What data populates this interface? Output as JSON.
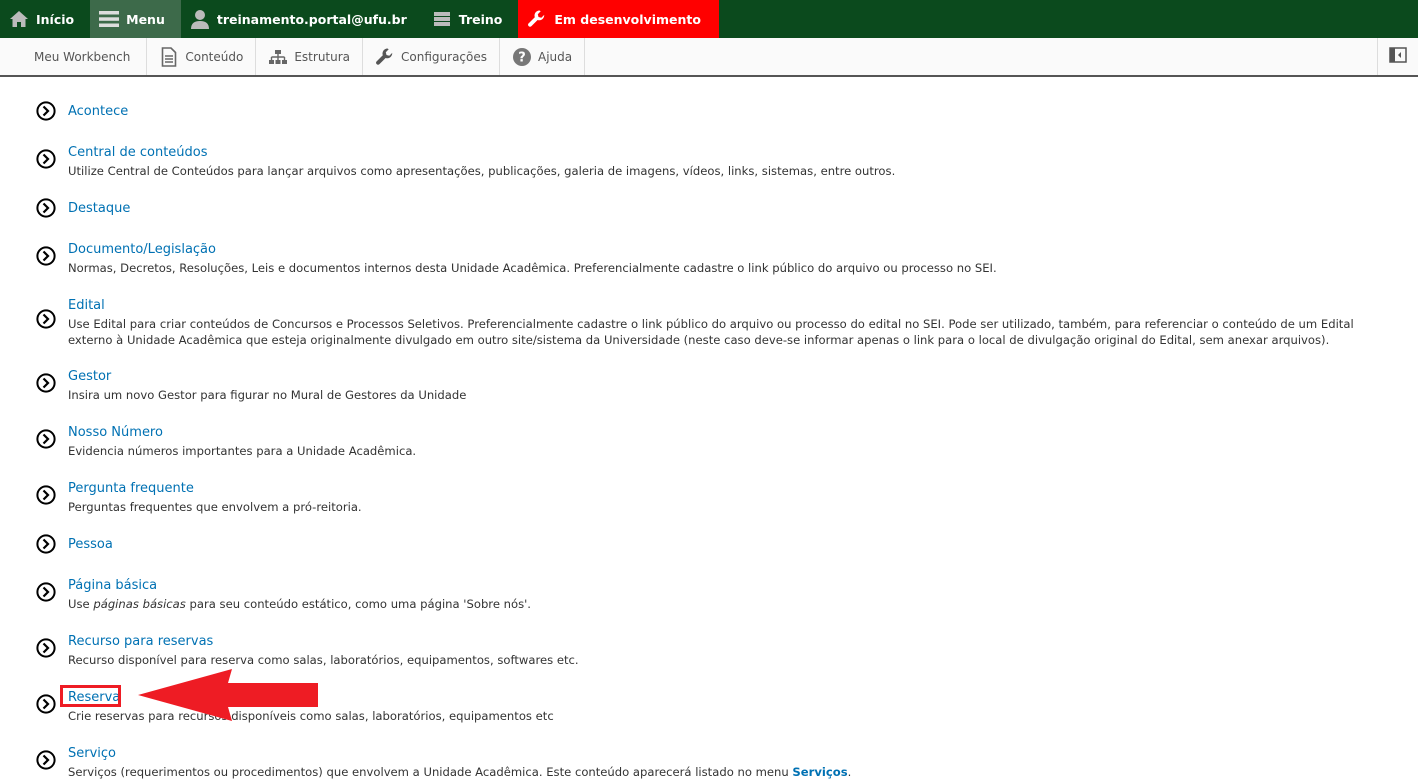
{
  "toolbar": {
    "inicio": "Início",
    "menu": "Menu",
    "user": "treinamento.portal@ufu.br",
    "treino": "Treino",
    "dev": "Em desenvolvimento"
  },
  "tray": {
    "workbench": "Meu Workbench",
    "conteudo": "Conteúdo",
    "estrutura": "Estrutura",
    "configuracoes": "Configurações",
    "ajuda": "Ajuda"
  },
  "items": [
    {
      "title": "Acontece",
      "desc": ""
    },
    {
      "title": "Central de conteúdos",
      "desc": "Utilize Central de Conteúdos para lançar arquivos como apresentações, publicações, galeria de imagens, vídeos, links, sistemas, entre outros."
    },
    {
      "title": "Destaque",
      "desc": ""
    },
    {
      "title": "Documento/Legislação",
      "desc": "Normas, Decretos, Resoluções, Leis e documentos internos desta Unidade Acadêmica. Preferencialmente cadastre o link público do arquivo ou processo no SEI."
    },
    {
      "title": "Edital",
      "desc": "Use Edital para criar conteúdos de Concursos e Processos Seletivos. Preferencialmente cadastre o link público do arquivo ou processo do edital no SEI. Pode ser utilizado, também, para referenciar o conteúdo de um Edital externo à Unidade Acadêmica que esteja originalmente divulgado em outro site/sistema da Universidade (neste caso deve-se informar apenas o link para o local de divulgação original do Edital, sem anexar arquivos)."
    },
    {
      "title": "Gestor",
      "desc": "Insira um novo Gestor para figurar no Mural de Gestores da Unidade"
    },
    {
      "title": "Nosso Número",
      "desc": "Evidencia números importantes para a Unidade Acadêmica."
    },
    {
      "title": "Pergunta frequente",
      "desc": "Perguntas frequentes que envolvem a pró-reitoria."
    },
    {
      "title": "Pessoa",
      "desc": ""
    },
    {
      "title": "Página básica",
      "desc_pre": "Use ",
      "desc_em": "páginas básicas",
      "desc_post": " para seu conteúdo estático, como uma página 'Sobre nós'."
    },
    {
      "title": "Recurso para reservas",
      "desc": "Recurso disponível para reserva como salas, laboratórios, equipamentos, softwares etc."
    },
    {
      "title": "Reserva",
      "desc": "Crie reservas para recursos disponíveis como salas, laboratórios, equipamentos etc"
    },
    {
      "title": "Serviço",
      "desc_pre": "Serviços (requerimentos ou procedimentos) que envolvem a Unidade Acadêmica. Este conteúdo aparecerá listado no menu ",
      "desc_link": "Serviços",
      "desc_post": "."
    }
  ],
  "colors": {
    "toolbar": "#0b4a1d",
    "dev": "#ff0000",
    "link": "#0071b3",
    "annotation": "#ee1c24"
  }
}
